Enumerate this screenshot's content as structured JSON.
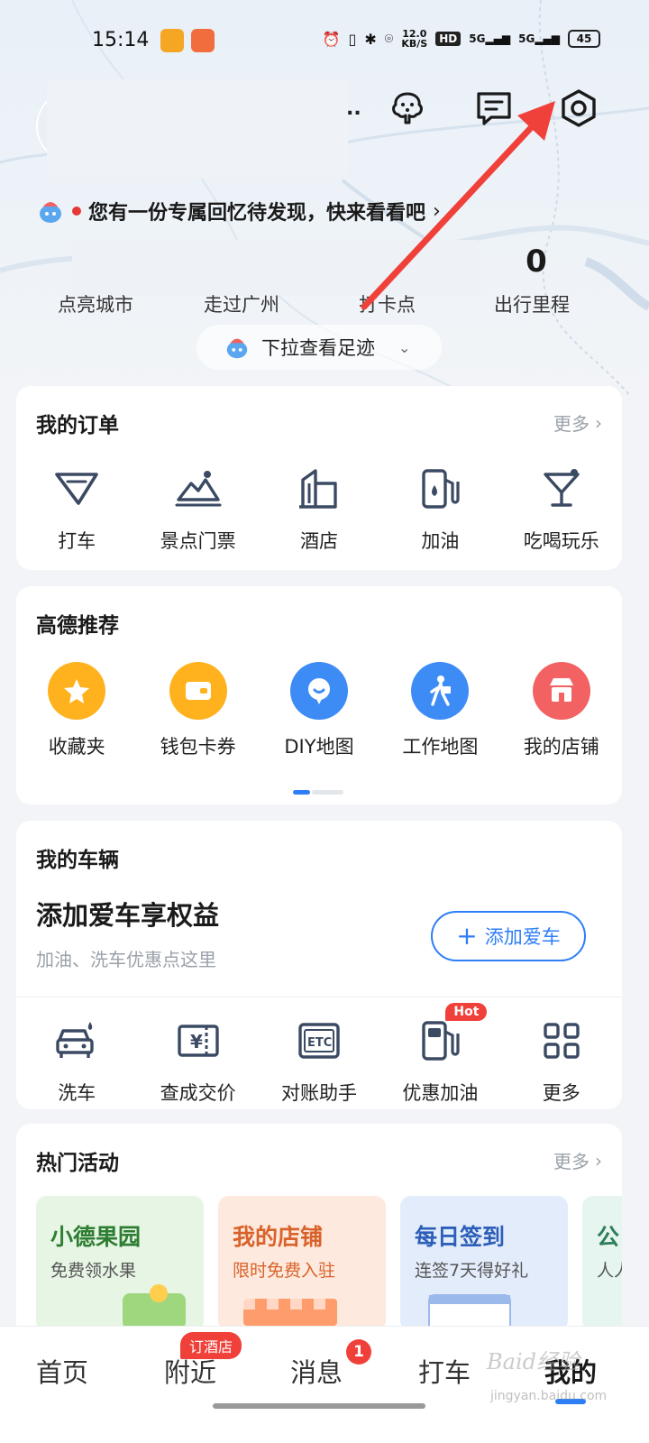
{
  "status_bar": {
    "time": "15:14",
    "net_speed_value": "12.0",
    "net_speed_unit": "KB/S",
    "hd": "HD",
    "signal1": "5G",
    "signal2": "5G",
    "battery": "45"
  },
  "header": {
    "name_suffix": "..",
    "memory_text": "您有一份专属回忆待发现，快来看看吧",
    "icons": [
      "tree-icon",
      "message-icon",
      "settings-icon"
    ]
  },
  "stats": {
    "mileage_value": "0",
    "labels": [
      "点亮城市",
      "走过广州",
      "打卡点",
      "出行里程"
    ]
  },
  "pull_down": {
    "label": "下拉查看足迹"
  },
  "orders": {
    "title": "我的订单",
    "more": "更多",
    "items": [
      {
        "label": "打车",
        "icon": "taxi-icon"
      },
      {
        "label": "景点门票",
        "icon": "mountain-icon"
      },
      {
        "label": "酒店",
        "icon": "building-icon"
      },
      {
        "label": "加油",
        "icon": "fuel-icon"
      },
      {
        "label": "吃喝玩乐",
        "icon": "cocktail-icon"
      }
    ]
  },
  "recommend": {
    "title": "高德推荐",
    "items": [
      {
        "label": "收藏夹",
        "icon": "star-icon",
        "color": "#ffb21e"
      },
      {
        "label": "钱包卡券",
        "icon": "wallet-icon",
        "color": "#ffb21e"
      },
      {
        "label": "DIY地图",
        "icon": "diy-map-icon",
        "color": "#3d8cf5"
      },
      {
        "label": "工作地图",
        "icon": "worker-icon",
        "color": "#3d8cf5"
      },
      {
        "label": "我的店铺",
        "icon": "shop-icon",
        "color": "#f26262"
      }
    ]
  },
  "vehicle": {
    "title": "我的车辆",
    "cta": "添加爱车享权益",
    "subtitle": "加油、洗车优惠点这里",
    "add_button": "添加爱车",
    "hot_badge": "Hot",
    "items": [
      {
        "label": "洗车",
        "icon": "car-wash-icon"
      },
      {
        "label": "查成交价",
        "icon": "price-icon"
      },
      {
        "label": "对账助手",
        "icon": "etc-icon"
      },
      {
        "label": "优惠加油",
        "icon": "fuel-icon"
      },
      {
        "label": "更多",
        "icon": "grid-icon"
      }
    ]
  },
  "activities": {
    "title": "热门活动",
    "more": "更多",
    "cards": [
      {
        "title": "小德果园",
        "subtitle": "免费领水果",
        "bg": "#e6f5e4",
        "fg": "#2e7d32"
      },
      {
        "title": "我的店铺",
        "subtitle": "限时免费入驻",
        "bg": "#fde9dd",
        "fg": "#d9622b"
      },
      {
        "title": "每日签到",
        "subtitle": "连签7天得好礼",
        "bg": "#e3ecfb",
        "fg": "#2d5fb8"
      },
      {
        "title": "公",
        "subtitle": "人人",
        "bg": "#e6f5ef",
        "fg": "#2e7d5a"
      }
    ]
  },
  "bottom_nav": {
    "items": [
      "首页",
      "附近",
      "消息",
      "打车",
      "我的"
    ],
    "active": "我的",
    "nearby_badge": "订酒店",
    "message_badge": "1"
  },
  "watermark": {
    "main": "Baid经验",
    "sub": "jingyan.baidu.com"
  },
  "colors": {
    "accent": "#2d7ef7",
    "annotation_arrow": "#f0403a"
  }
}
